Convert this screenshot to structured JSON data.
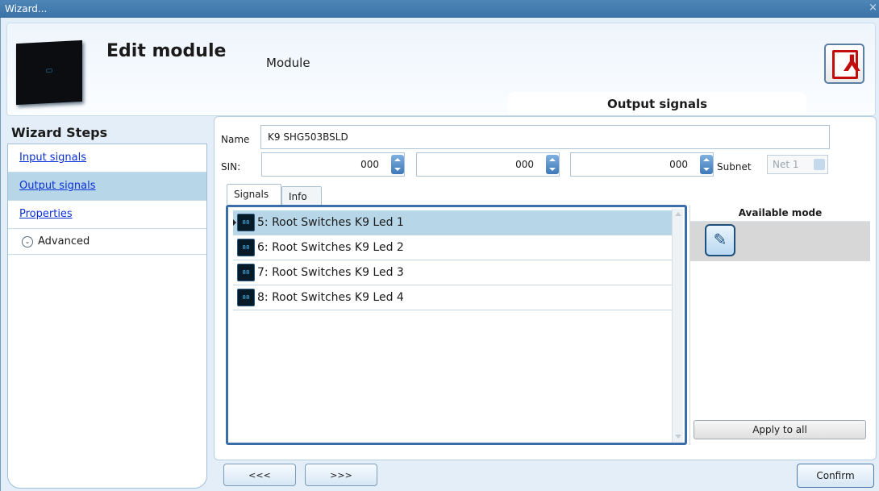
{
  "window": {
    "title": "Wizard...",
    "close_glyph": "×"
  },
  "header": {
    "title": "Edit module",
    "subtitle": "Module",
    "pdf_icon": "pdf-icon",
    "pdf_glyph": "⅄",
    "active_section": "Output signals"
  },
  "wizard": {
    "title": "Wizard Steps",
    "steps": [
      {
        "label": "Input signals"
      },
      {
        "label": "Output signals"
      },
      {
        "label": "Properties"
      }
    ],
    "advanced": {
      "label": "Advanced",
      "glyph": "⌄"
    }
  },
  "form": {
    "name_label": "Name",
    "name_value": "K9 SHG503BSLD",
    "sin_label": "SIN:",
    "sin_values": [
      "000",
      "000",
      "000"
    ],
    "subnet_label": "Subnet",
    "subnet_value": "Net 1"
  },
  "tabs": [
    {
      "label": "Signals"
    },
    {
      "label": "Info"
    }
  ],
  "signals": {
    "icon_text": "88",
    "items": [
      {
        "label": "5: Root Switches K9 Led 1"
      },
      {
        "label": "6: Root Switches K9 Led 2"
      },
      {
        "label": "7: Root Switches K9 Led 3"
      },
      {
        "label": "8: Root Switches K9 Led 4"
      }
    ]
  },
  "modes": {
    "header": "Available mode",
    "mode_icon": "light-bulb-icon",
    "mode_glyph": "✎",
    "apply_label": "Apply to all"
  },
  "footer": {
    "back_label": "<<<",
    "next_label": ">>>",
    "confirm_label": "Confirm"
  },
  "colors": {
    "accent": "#3b6ea8",
    "selected_row": "#b7d6e8",
    "link": "#0a2fd6"
  }
}
